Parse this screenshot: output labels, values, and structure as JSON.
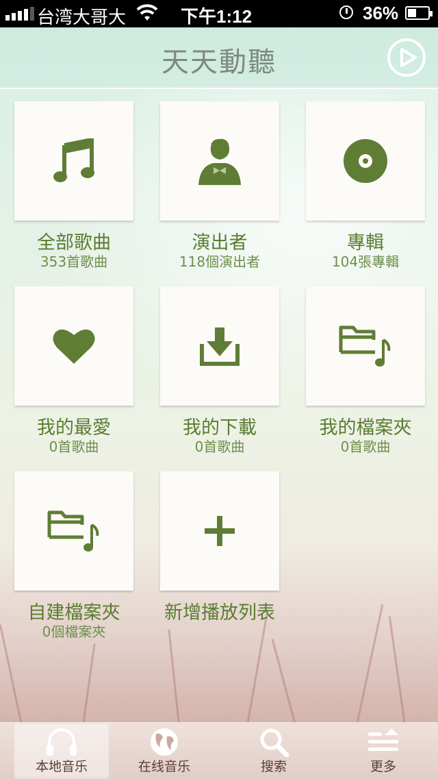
{
  "status_bar": {
    "carrier": "台湾大哥大",
    "time": "下午1:12",
    "battery_percent": "36%"
  },
  "header": {
    "title": "天天動聽"
  },
  "grid": [
    {
      "label": "全部歌曲",
      "sub": "353首歌曲",
      "icon": "music-note-icon"
    },
    {
      "label": "演出者",
      "sub": "118個演出者",
      "icon": "artist-icon"
    },
    {
      "label": "專輯",
      "sub": "104張專輯",
      "icon": "album-disc-icon"
    },
    {
      "label": "我的最愛",
      "sub": "0首歌曲",
      "icon": "heart-icon"
    },
    {
      "label": "我的下載",
      "sub": "0首歌曲",
      "icon": "download-icon"
    },
    {
      "label": "我的檔案夾",
      "sub": "0首歌曲",
      "icon": "music-folder-icon"
    },
    {
      "label": "自建檔案夾",
      "sub": "0個檔案夾",
      "icon": "music-folder-icon"
    },
    {
      "label": "新增播放列表",
      "sub": "",
      "icon": "plus-icon"
    }
  ],
  "tabbar": [
    {
      "label": "本地音乐",
      "icon": "headphones-icon",
      "active": true
    },
    {
      "label": "在线音乐",
      "icon": "globe-icon",
      "active": false
    },
    {
      "label": "搜索",
      "icon": "search-icon",
      "active": false
    },
    {
      "label": "更多",
      "icon": "more-icon",
      "active": false
    }
  ],
  "colors": {
    "accent_green": "#5a7d31",
    "icon_green": "#5f7d35",
    "tab_text": "#5a3f35"
  }
}
